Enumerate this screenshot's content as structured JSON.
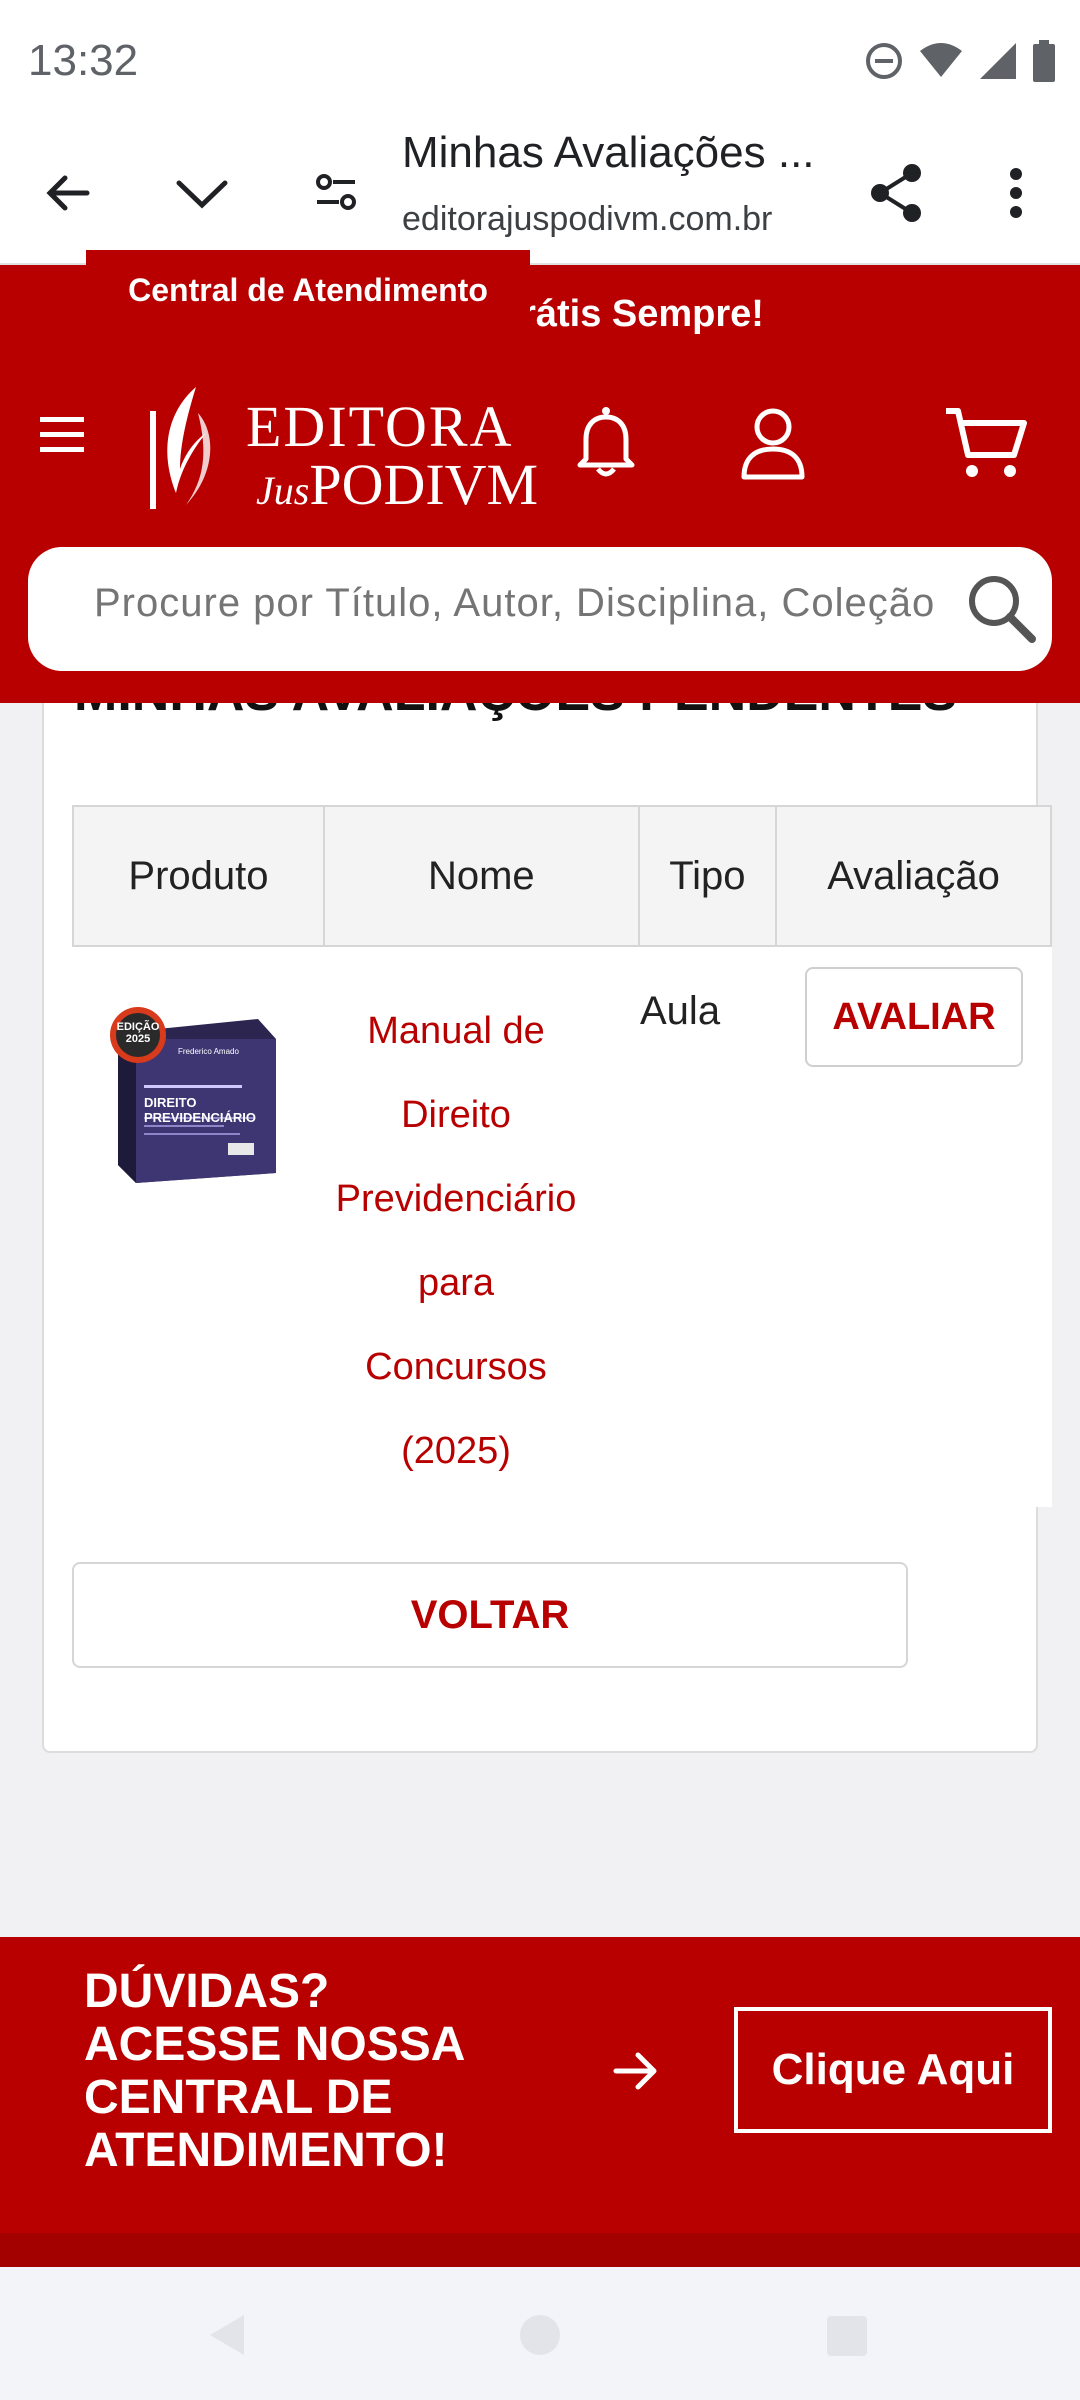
{
  "status_bar": {
    "time": "13:32"
  },
  "browser": {
    "title": "Minhas Avaliações ...",
    "url": "editorajuspodivm.com.br"
  },
  "header": {
    "promo": "Frete Grátis Sempre!",
    "logo_line1": "EDITORA",
    "logo_line2a": "Jus",
    "logo_line2b": "PODIVM",
    "search_placeholder": "Procure por Título, Autor, Disciplina, Coleção"
  },
  "page": {
    "section_title": "MINHAS AVALIAÇÕES PENDENTES",
    "table": {
      "headers": [
        "Produto",
        "Nome",
        "Tipo",
        "Avaliação"
      ],
      "rows": [
        {
          "name_lines": [
            "Manual de",
            "Direito",
            "Previdenciário",
            "para",
            "Concursos",
            "(2025)"
          ],
          "type": "Aula",
          "action": "AVALIAR",
          "cover_badge_line1": "EDIÇÃO",
          "cover_badge_line2": "2025",
          "cover_author": "Frederico Amado",
          "cover_title_line1": "DIREITO",
          "cover_title_line2": "PREVIDENCIÁRIO"
        }
      ]
    },
    "back_button": "VOLTAR"
  },
  "footer": {
    "lines": [
      "DÚVIDAS?",
      "ACESSE NOSSA",
      "CENTRAL DE",
      "ATENDIMENTO!"
    ],
    "cta": "Clique Aqui",
    "tab": "Central de Atendimento"
  },
  "colors": {
    "brand_red": "#b80000",
    "white": "#ffffff"
  },
  "icons": [
    "dnd-icon",
    "wifi-icon",
    "signal-icon",
    "battery-icon",
    "back-arrow-icon",
    "chevron-down-icon",
    "tune-icon",
    "share-icon",
    "more-vert-icon",
    "truck-icon",
    "menu-icon",
    "bell-icon",
    "user-icon",
    "cart-icon",
    "search-icon",
    "arrow-right-icon",
    "nav-back-icon",
    "nav-home-icon",
    "nav-recents-icon"
  ]
}
